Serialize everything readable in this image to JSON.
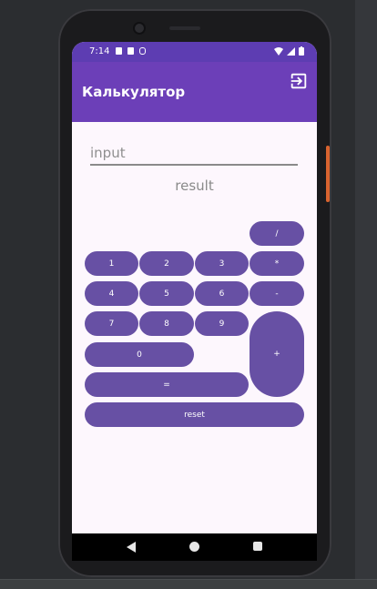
{
  "status_bar": {
    "time": "7:14"
  },
  "app_bar": {
    "title": "Калькулятор",
    "exit_icon": "exit-to-app-icon"
  },
  "calculator": {
    "input_placeholder": "input",
    "result_text": "result",
    "buttons": {
      "divide": "/",
      "one": "1",
      "two": "2",
      "three": "3",
      "multiply": "*",
      "four": "4",
      "five": "5",
      "six": "6",
      "minus": "-",
      "seven": "7",
      "eight": "8",
      "nine": "9",
      "plus": "+",
      "zero": "0",
      "equals": "=",
      "reset": "reset"
    }
  },
  "nav_bar": {
    "back_icon": "back-triangle-icon",
    "home_icon": "home-circle-icon",
    "recents_icon": "recents-square-icon"
  },
  "colors": {
    "app_bar": "#6c3fb8",
    "status_bar": "#5d3db2",
    "button": "#6750a4",
    "screen_bg": "#fdf7fd"
  }
}
